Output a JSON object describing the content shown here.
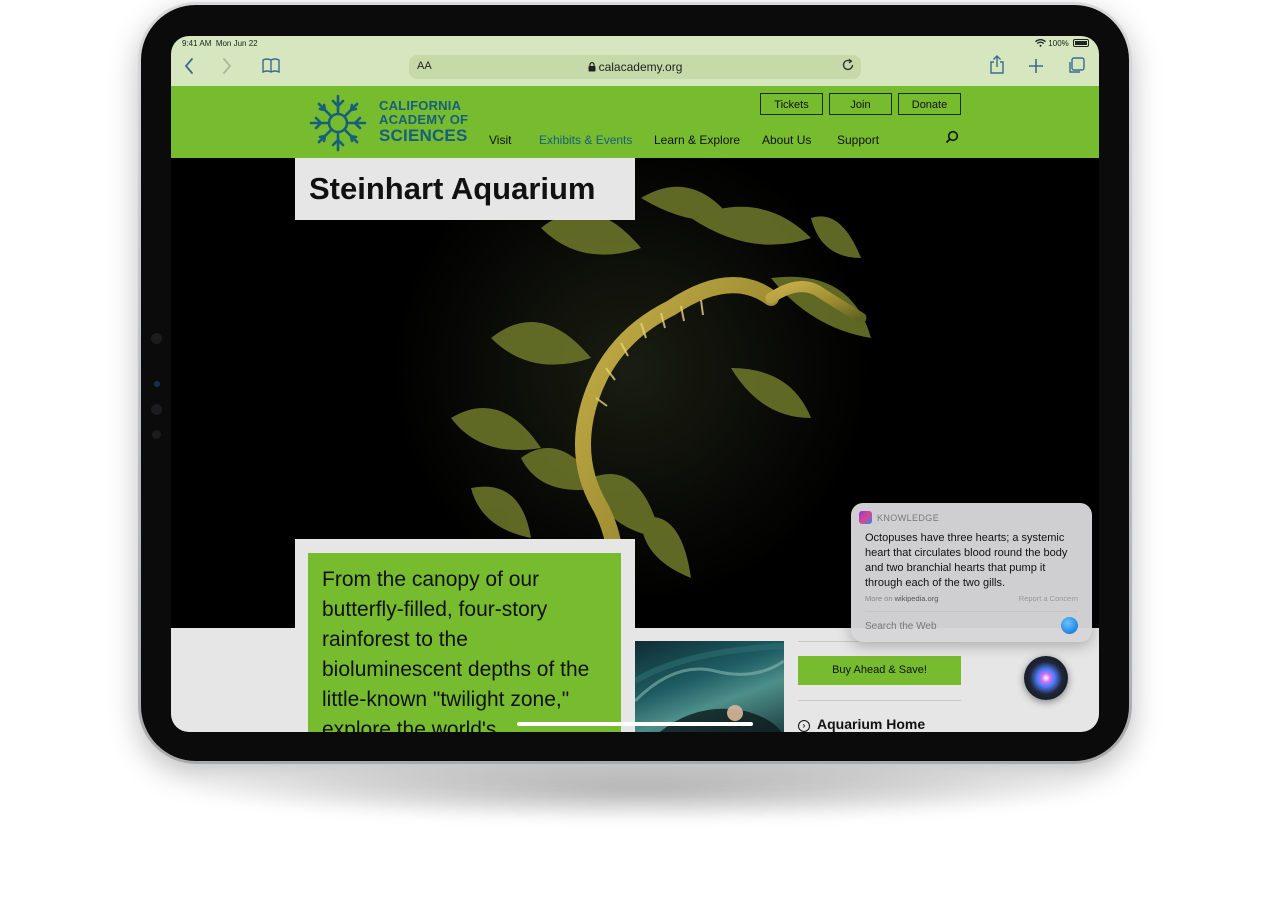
{
  "status_bar": {
    "time": "9:41 AM",
    "date": "Mon Jun 22",
    "battery": "100%"
  },
  "browser": {
    "text_size_label": "AA",
    "url": "calacademy.org",
    "icons": [
      "back-icon",
      "forward-icon",
      "bookmarks-icon",
      "lock-icon",
      "reload-icon",
      "share-icon",
      "new-tab-icon",
      "tabs-icon"
    ]
  },
  "site": {
    "logo": {
      "line1": "CALIFORNIA",
      "line2": "ACADEMY OF",
      "line3": "SCIENCES"
    },
    "header_buttons": {
      "tickets": "Tickets",
      "join": "Join",
      "donate": "Donate"
    },
    "nav": {
      "visit": "Visit",
      "exhibits": "Exhibits & Events",
      "learn": "Learn & Explore",
      "about": "About Us",
      "support": "Support"
    },
    "page_title": "Steinhart Aquarium",
    "promo_text": "From the canopy of our butterfly-filled, four-story rainforest to the bioluminescent depths of the little-known \"twilight zone,\" explore the world's",
    "buy_button": "Buy Ahead & Save!",
    "aquarium_home": "Aquarium Home"
  },
  "siri_card": {
    "header": "KNOWLEDGE",
    "body": "Octopuses have three hearts; a systemic heart that circulates blood round the body and two branchial hearts that pump it through each of the two gills.",
    "more_on": "More on",
    "source": "wikipedia.org",
    "report": "Report a Concern",
    "search_placeholder": "Search the Web"
  },
  "colors": {
    "site_green": "#77bb2f",
    "logo_teal": "#17607a",
    "toolbar_tint": "#d6e6bf"
  }
}
